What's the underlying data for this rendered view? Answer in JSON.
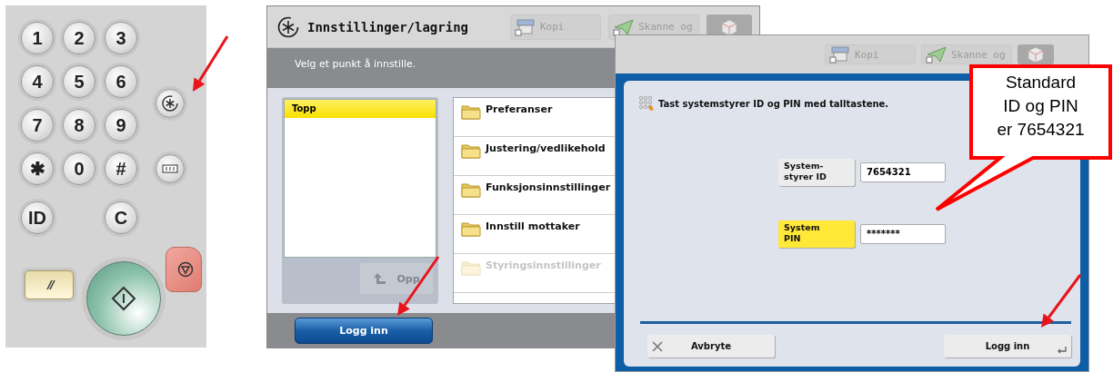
{
  "keypad": {
    "number_keys": [
      "1",
      "2",
      "3",
      "4",
      "5",
      "6",
      "7",
      "8",
      "9",
      "✱",
      "0",
      "#"
    ],
    "id_key": "ID",
    "clear_key": "C"
  },
  "settings_screen": {
    "title": "Innstillinger/lagring",
    "toolbar": [
      "Kopi",
      "Skanne og"
    ],
    "instruction": "Velg et punkt å innstille.",
    "tree": [
      {
        "label": "Topp",
        "selected": true
      }
    ],
    "up_button": {
      "label": "Opp",
      "disabled": true
    },
    "items": [
      {
        "label": "Preferanser",
        "disabled": false
      },
      {
        "label": "Justering/vedlikehold",
        "disabled": false
      },
      {
        "label": "Funksjonsinnstillinger",
        "disabled": false
      },
      {
        "label": "Innstill mottaker",
        "disabled": false
      },
      {
        "label": "Styringsinnstillinger",
        "disabled": true
      }
    ],
    "login_button": "Logg inn"
  },
  "login_dialog": {
    "toolbar": [
      "Kopi",
      "Skanne og"
    ],
    "message": "Tast systemstyrer ID og PIN med talltastene.",
    "fields": [
      {
        "label": "System-\nstyrer ID",
        "value": "7654321",
        "selected": false
      },
      {
        "label": "System\nPIN",
        "value": "*******",
        "selected": true
      }
    ],
    "buttons": [
      {
        "label": "Avbryte",
        "kind": "cancel"
      },
      {
        "label": "Logg inn",
        "kind": "confirm"
      }
    ]
  },
  "callout": {
    "text": "Standard\nID og PIN\ner 7654321"
  }
}
